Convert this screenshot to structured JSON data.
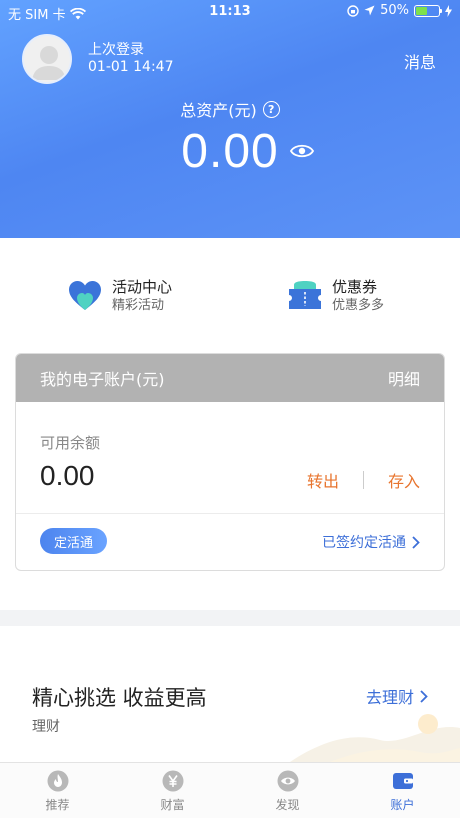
{
  "status_bar": {
    "carrier": "无 SIM 卡",
    "time": "11:13",
    "battery": "50%",
    "battery_level": 0.5
  },
  "header": {
    "login_label": "上次登录",
    "login_time": "01-01 14:47",
    "messages_label": "消息",
    "total_assets_label": "总资产(元)",
    "total_assets_value": "0.00"
  },
  "quick_entries": [
    {
      "title": "活动中心",
      "subtitle": "精彩活动",
      "icon": "heart-icon"
    },
    {
      "title": "优惠券",
      "subtitle": "优惠多多",
      "icon": "ticket-icon"
    }
  ],
  "account_card": {
    "title": "我的电子账户(元)",
    "detail_label": "明细",
    "balance_label": "可用余额",
    "balance_value": "0.00",
    "transfer_out_label": "转出",
    "deposit_label": "存入",
    "badge_label": "定活通",
    "signed_label": "已签约定活通"
  },
  "finance": {
    "title": "精心挑选 收益更高",
    "subtitle": "理财",
    "link_label": "去理财"
  },
  "tabs": [
    {
      "label": "推荐",
      "icon": "flame-icon",
      "active": false
    },
    {
      "label": "财富",
      "icon": "yen-icon",
      "active": false
    },
    {
      "label": "发现",
      "icon": "eye-icon",
      "active": false
    },
    {
      "label": "账户",
      "icon": "wallet-icon",
      "active": true
    }
  ],
  "colors": {
    "header_blue": "#4e86f2",
    "accent_orange": "#e8752f",
    "link_blue": "#3d6fd8",
    "tab_inactive": "#888888"
  }
}
